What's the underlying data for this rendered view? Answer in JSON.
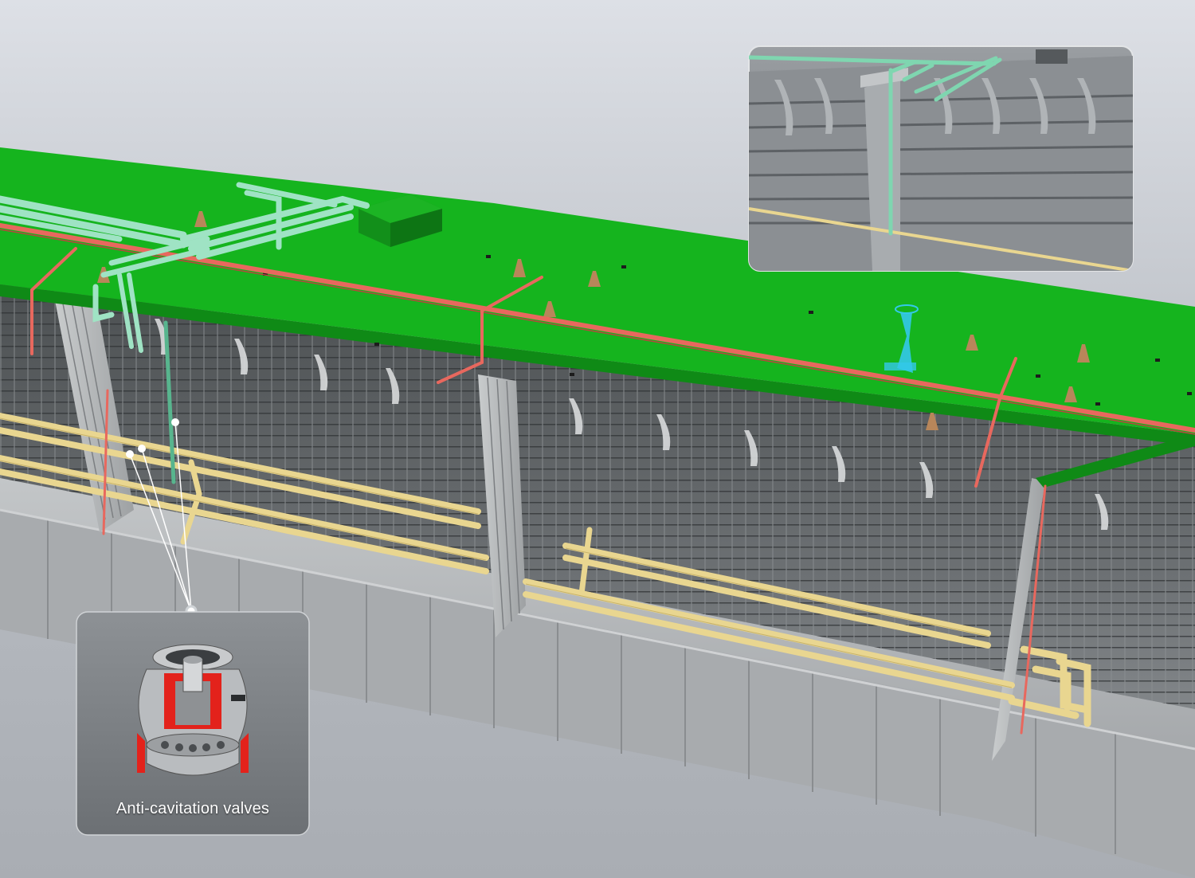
{
  "callout": {
    "label": "Anti-cavitation valves"
  },
  "colors": {
    "deck": "#15b41e",
    "deck_edge": "#0f8a16",
    "red_pipe": "#e8685e",
    "mint_pipe": "#9fe3c4",
    "yellow_pipe": "#e9d690",
    "steel": "#9a9d9f",
    "valve_accent": "#e3221b",
    "marker_cyan": "#33c8ea",
    "panel": "#808488"
  }
}
